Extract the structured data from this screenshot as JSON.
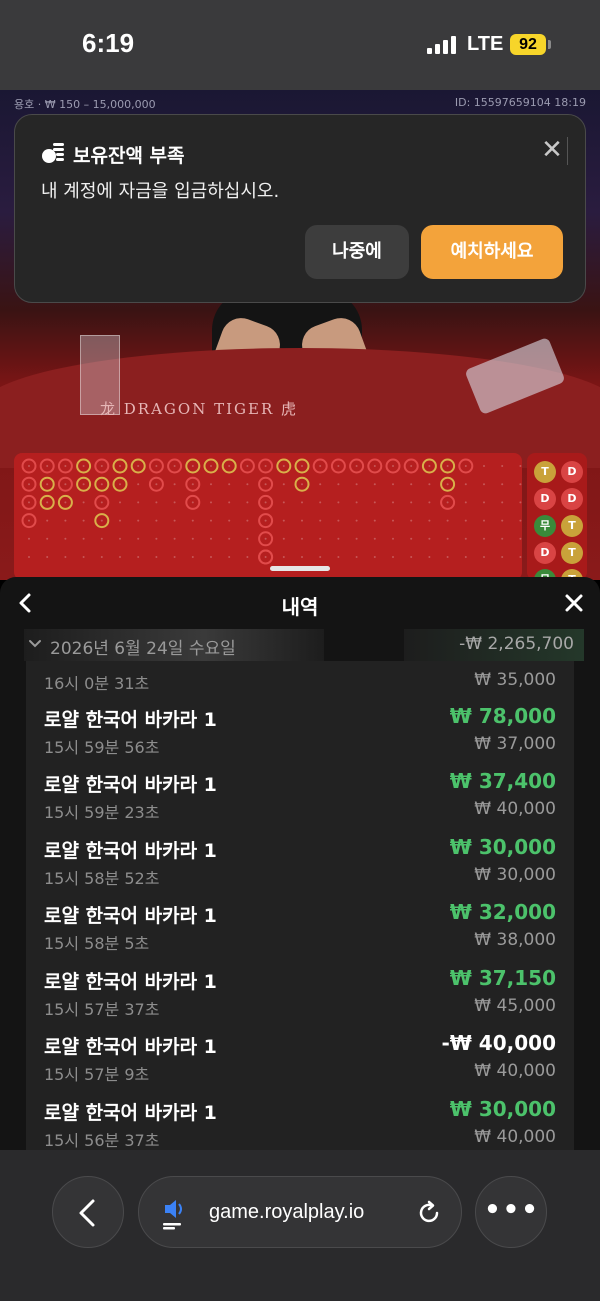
{
  "status_bar": {
    "time": "6:19",
    "network": "LTE",
    "battery": "92"
  },
  "game": {
    "limits": "용호 · ₩ 150 – 15,000,000",
    "round_id": "ID: 15597659104 18:19",
    "table_label": "龙 DRAGON TIGER 虎",
    "side_road": [
      "T",
      "D",
      "D",
      "D",
      "무",
      "T",
      "D",
      "T",
      "무",
      "T"
    ]
  },
  "toast": {
    "title": "보유잔액 부족",
    "message": "내 계정에 자금을 입금하십시오.",
    "later_label": "나중에",
    "deposit_label": "예치하세요",
    "icon": "coins-icon"
  },
  "history": {
    "title": "내역",
    "date": "2026년 6월 24일 수요일",
    "day_total": "-₩ 2,265,700",
    "partial_row": {
      "time": "16시 0분 31초",
      "bet": "₩ 35,000"
    },
    "rows": [
      {
        "name": "로얄 한국어 바카라 1",
        "time": "15시 59분 56초",
        "amount": "₩ 78,000",
        "bet": "₩ 37,000",
        "win": true
      },
      {
        "name": "로얄 한국어 바카라 1",
        "time": "15시 59분 23초",
        "amount": "₩ 37,400",
        "bet": "₩ 40,000",
        "win": true
      },
      {
        "name": "로얄 한국어 바카라 1",
        "time": "15시 58분 52초",
        "amount": "₩ 30,000",
        "bet": "₩ 30,000",
        "win": true
      },
      {
        "name": "로얄 한국어 바카라 1",
        "time": "15시 58분 5초",
        "amount": "₩ 32,000",
        "bet": "₩ 38,000",
        "win": true
      },
      {
        "name": "로얄 한국어 바카라 1",
        "time": "15시 57분 37초",
        "amount": "₩ 37,150",
        "bet": "₩ 45,000",
        "win": true
      },
      {
        "name": "로얄 한국어 바카라 1",
        "time": "15시 57분 9초",
        "amount": "-₩ 40,000",
        "bet": "₩ 40,000",
        "win": false
      },
      {
        "name": "로얄 한국어 바카라 1",
        "time": "15시 56분 37초",
        "amount": "₩ 30,000",
        "bet": "₩ 40,000",
        "win": true
      }
    ]
  },
  "browser": {
    "url": "game.royalplay.io"
  },
  "colors": {
    "accent": "#f3a33b",
    "win": "#4cc26b",
    "sheet": "#141414"
  }
}
